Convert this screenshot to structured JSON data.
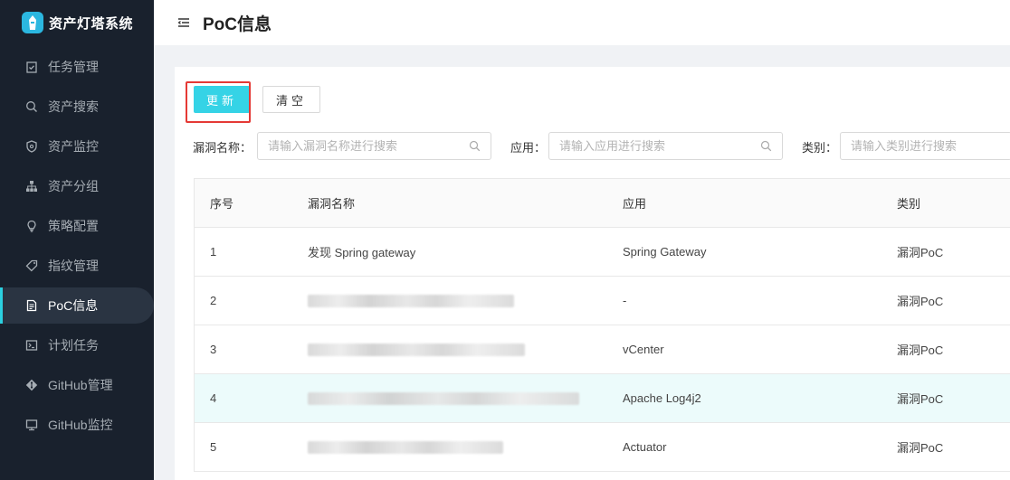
{
  "app": {
    "title": "资产灯塔系统"
  },
  "sidebar": {
    "items": [
      {
        "label": "任务管理",
        "icon": "task-icon",
        "active": false
      },
      {
        "label": "资产搜索",
        "icon": "search-icon",
        "active": false
      },
      {
        "label": "资产监控",
        "icon": "shield-icon",
        "active": false
      },
      {
        "label": "资产分组",
        "icon": "sitemap-icon",
        "active": false
      },
      {
        "label": "策略配置",
        "icon": "bulb-icon",
        "active": false
      },
      {
        "label": "指纹管理",
        "icon": "tag-icon",
        "active": false
      },
      {
        "label": "PoC信息",
        "icon": "document-icon",
        "active": true
      },
      {
        "label": "计划任务",
        "icon": "terminal-icon",
        "active": false
      },
      {
        "label": "GitHub管理",
        "icon": "git-icon",
        "active": false
      },
      {
        "label": "GitHub监控",
        "icon": "monitor-icon",
        "active": false
      }
    ]
  },
  "header": {
    "title": "PoC信息"
  },
  "toolbar": {
    "update_label": "更新",
    "clear_label": "清空"
  },
  "filters": {
    "vuln_name_label": "漏洞名称：",
    "vuln_name_placeholder": "请输入漏洞名称进行搜索",
    "app_label": "应用：",
    "app_placeholder": "请输入应用进行搜索",
    "category_label": "类别：",
    "category_placeholder": "请输入类别进行搜索"
  },
  "table": {
    "headers": [
      "序号",
      "漏洞名称",
      "应用",
      "类别"
    ],
    "rows": [
      {
        "index": "1",
        "name": "发现 Spring gateway",
        "app": "Spring Gateway",
        "category": "漏洞PoC",
        "redacted": false
      },
      {
        "index": "2",
        "name": "",
        "app": "-",
        "category": "漏洞PoC",
        "redacted": true
      },
      {
        "index": "3",
        "name": "",
        "app": "vCenter",
        "category": "漏洞PoC",
        "redacted": true
      },
      {
        "index": "4",
        "name": "",
        "app": "Apache Log4j2",
        "category": "漏洞PoC",
        "redacted": true,
        "highlighted": true
      },
      {
        "index": "5",
        "name": "",
        "app": "Actuator",
        "category": "漏洞PoC",
        "redacted": true
      }
    ]
  },
  "colors": {
    "accent": "#35d3e6",
    "sidebar_bg": "#19212d",
    "highlight_outline": "#e53935",
    "row_highlight": "#ecfbfb"
  }
}
